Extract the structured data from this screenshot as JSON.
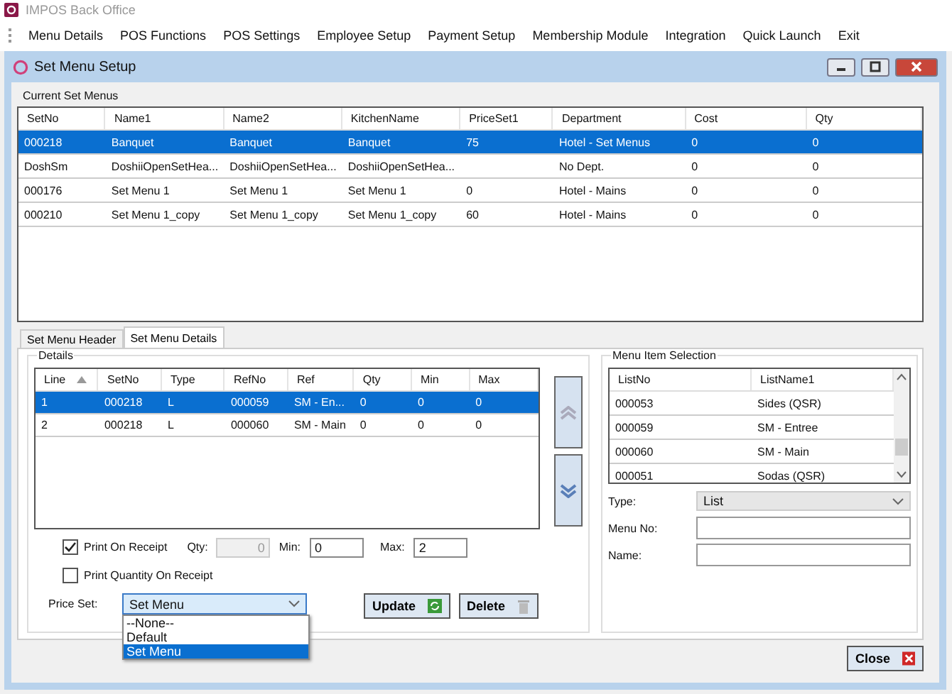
{
  "app_title": "IMPOS Back Office",
  "menu": [
    "Menu Details",
    "POS Functions",
    "POS Settings",
    "Employee Setup",
    "Payment Setup",
    "Membership Module",
    "Integration",
    "Quick Launch",
    "Exit"
  ],
  "window": {
    "title": "Set Menu Setup"
  },
  "current_set_menus": {
    "label": "Current Set Menus",
    "columns": [
      "SetNo",
      "Name1",
      "Name2",
      "KitchenName",
      "PriceSet1",
      "Department",
      "Cost",
      "Qty"
    ],
    "rows": [
      {
        "cells": [
          "000218",
          "Banquet",
          "Banquet",
          "Banquet",
          "75",
          "Hotel - Set Menus",
          "0",
          "0"
        ],
        "selected": true
      },
      {
        "cells": [
          "DoshSm",
          "DoshiiOpenSetHea...",
          "DoshiiOpenSetHea...",
          "DoshiiOpenSetHea...",
          "",
          "No Dept.",
          "0",
          "0"
        ],
        "selected": false
      },
      {
        "cells": [
          "000176",
          "Set Menu 1",
          "Set Menu 1",
          "Set Menu 1",
          "0",
          "Hotel - Mains",
          "0",
          "0"
        ],
        "selected": false
      },
      {
        "cells": [
          "000210",
          "Set Menu 1_copy",
          "Set Menu 1_copy",
          "Set Menu 1_copy",
          "60",
          "Hotel - Mains",
          "0",
          "0"
        ],
        "selected": false
      }
    ]
  },
  "tabs": [
    {
      "label": "Set Menu Header",
      "selected": false
    },
    {
      "label": "Set Menu Details",
      "selected": true
    }
  ],
  "details": {
    "label": "Details",
    "columns": [
      "Line",
      "SetNo",
      "Type",
      "RefNo",
      "Ref",
      "Qty",
      "Min",
      "Max"
    ],
    "rows": [
      {
        "cells": [
          "1",
          "000218",
          "L",
          "000059",
          "SM - En...",
          "0",
          "0",
          "0"
        ],
        "selected": true
      },
      {
        "cells": [
          "2",
          "000218",
          "L",
          "000060",
          "SM - Main",
          "0",
          "0",
          "0"
        ],
        "selected": false
      }
    ],
    "print_on_receipt": {
      "label": "Print On Receipt",
      "checked": true
    },
    "qty": {
      "label": "Qty:",
      "value": "0",
      "disabled": true
    },
    "min": {
      "label": "Min:",
      "value": "0"
    },
    "max": {
      "label": "Max:",
      "value": "2"
    },
    "print_quantity": {
      "label": "Print Quantity On Receipt",
      "checked": false
    },
    "price_set": {
      "label": "Price Set:",
      "value": "Set Menu",
      "options": [
        {
          "label": "--None--",
          "selected": false
        },
        {
          "label": "Default",
          "selected": false
        },
        {
          "label": "Set Menu",
          "selected": true
        }
      ]
    },
    "update_button": "Update",
    "delete_button": "Delete"
  },
  "menu_item_selection": {
    "label": "Menu Item Selection",
    "columns": [
      "ListNo",
      "ListName1"
    ],
    "rows": [
      {
        "cells": [
          "000053",
          "Sides (QSR)"
        ]
      },
      {
        "cells": [
          "000059",
          "SM - Entree"
        ]
      },
      {
        "cells": [
          "000060",
          "SM - Main"
        ]
      },
      {
        "cells": [
          "000051",
          "Sodas (QSR)"
        ]
      }
    ],
    "type": {
      "label": "Type:",
      "value": "List"
    },
    "menu_no": {
      "label": "Menu No:"
    },
    "name": {
      "label": "Name:"
    }
  },
  "close_button": "Close"
}
